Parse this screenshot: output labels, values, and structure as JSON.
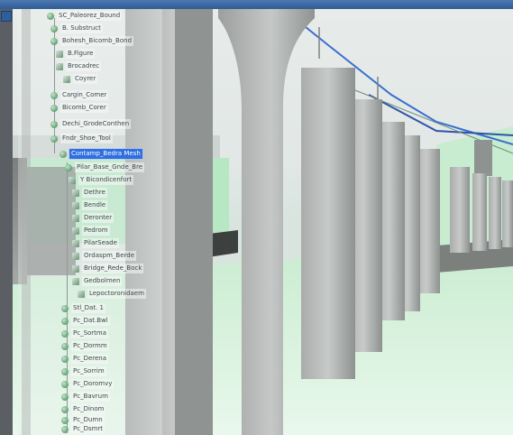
{
  "tree": {
    "items": [
      {
        "label": "SC_Paleorez_Bound"
      },
      {
        "label": "B. Substruct"
      },
      {
        "label": "Bohesh_Bicomb_Bond"
      },
      {
        "label": "B.Figure"
      },
      {
        "label": "Brocadrec"
      },
      {
        "label": "Coyrer"
      },
      {
        "label": "Cargin_Comer"
      },
      {
        "label": "Bicomb_Corer"
      },
      {
        "label": "Dechi_GrodeConthen"
      },
      {
        "label": "Fndr_Shoe_Tool"
      },
      {
        "label": "Contamp_Bedra Mesh",
        "selected": true
      },
      {
        "label": "Pilar_Base_Gnde_Bre"
      },
      {
        "label": "Y Bicondicenfort"
      },
      {
        "label": "Dethre"
      },
      {
        "label": "Bendle"
      },
      {
        "label": "Deronter"
      },
      {
        "label": "Pedrom"
      },
      {
        "label": "PilarSeade"
      },
      {
        "label": "Ordaspm_Berde"
      },
      {
        "label": "Bridge_Rede_Bock"
      },
      {
        "label": "Gedbolmen"
      },
      {
        "label": "Lepoctoronidaem"
      },
      {
        "label": "Stl_Dat. 1"
      },
      {
        "label": "Pc_Dat.Bwl"
      },
      {
        "label": "Pc_Sortma"
      },
      {
        "label": "Pc_Dormm"
      },
      {
        "label": "Pc_Derena"
      },
      {
        "label": "Pc_Sorrim"
      },
      {
        "label": "Pc_Doromvy"
      },
      {
        "label": "Pc_Bavrum"
      },
      {
        "label": "Pc_Dinom"
      },
      {
        "label": "Pc_Dumn"
      },
      {
        "label": "Pc_Dsmrt"
      }
    ]
  },
  "colors": {
    "selection": "#2f6fe0",
    "ground": "#d3f0d8",
    "pillar": "#b3b6b5",
    "titlebar": "#3c6aa5",
    "cable": "#3a6fd0"
  },
  "icons": {
    "node": "sphere-node-icon",
    "leaf": "mesh-leaf-icon"
  }
}
